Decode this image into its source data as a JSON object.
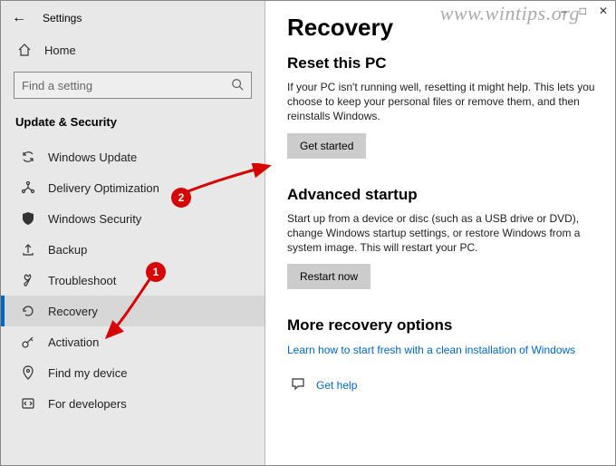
{
  "app_title": "Settings",
  "watermark": "www.wintips.org",
  "home_label": "Home",
  "search_placeholder": "Find a setting",
  "section_title": "Update & Security",
  "nav": [
    {
      "label": "Windows Update"
    },
    {
      "label": "Delivery Optimization"
    },
    {
      "label": "Windows Security"
    },
    {
      "label": "Backup"
    },
    {
      "label": "Troubleshoot"
    },
    {
      "label": "Recovery"
    },
    {
      "label": "Activation"
    },
    {
      "label": "Find my device"
    },
    {
      "label": "For developers"
    }
  ],
  "page": {
    "title": "Recovery",
    "reset": {
      "heading": "Reset this PC",
      "body": "If your PC isn't running well, resetting it might help. This lets you choose to keep your personal files or remove them, and then reinstalls Windows.",
      "button": "Get started"
    },
    "advanced": {
      "heading": "Advanced startup",
      "body": "Start up from a device or disc (such as a USB drive or DVD), change Windows startup settings, or restore Windows from a system image. This will restart your PC.",
      "button": "Restart now"
    },
    "more": {
      "heading": "More recovery options",
      "link": "Learn how to start fresh with a clean installation of Windows"
    },
    "help_label": "Get help"
  },
  "annotations": {
    "badge1": "1",
    "badge2": "2"
  }
}
